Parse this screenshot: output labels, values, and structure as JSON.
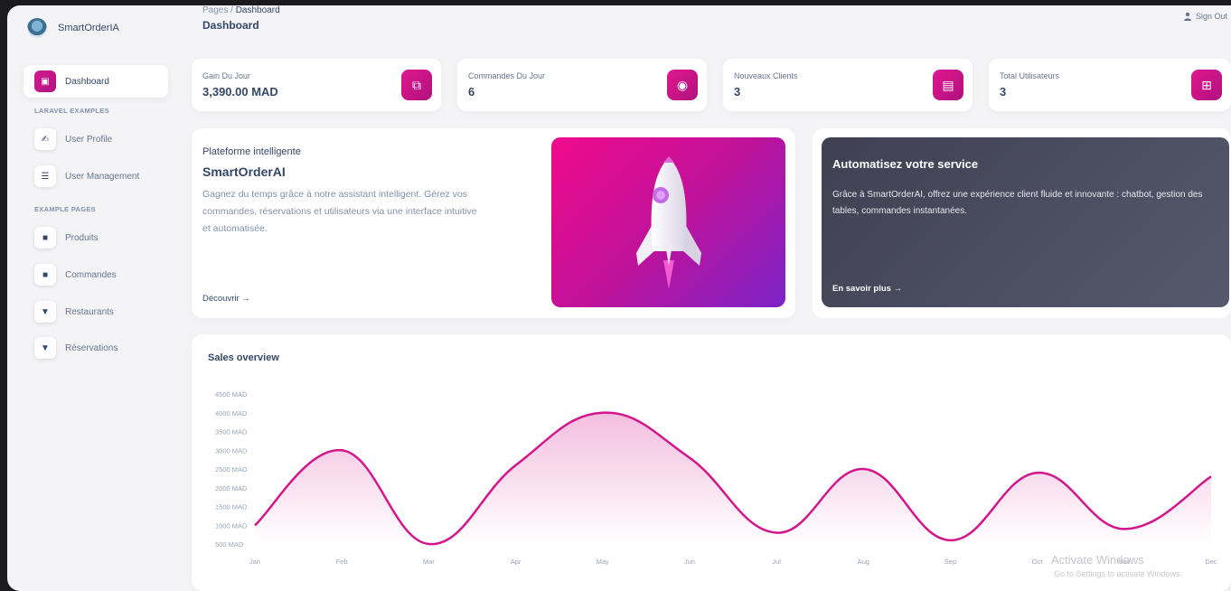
{
  "brand": {
    "name": "SmartOrderIA"
  },
  "breadcrumb": {
    "root": "Pages",
    "separator": "/",
    "current": "Dashboard"
  },
  "page_title": "Dashboard",
  "signout": "Sign Out",
  "sidebar": {
    "items": [
      {
        "label": "Dashboard",
        "icon": "dashboard-icon",
        "glyph": "▣"
      },
      {
        "label": "User Profile",
        "icon": "user-profile-icon",
        "glyph": "✍"
      },
      {
        "label": "User Management",
        "icon": "list-icon",
        "glyph": "☰"
      },
      {
        "label": "Produits",
        "icon": "box-icon",
        "glyph": "■"
      },
      {
        "label": "Commandes",
        "icon": "cart-icon",
        "glyph": "■"
      },
      {
        "label": "Restaurants",
        "icon": "restaurant-icon",
        "glyph": "▼"
      },
      {
        "label": "Réservations",
        "icon": "reservation-icon",
        "glyph": "▼"
      }
    ],
    "sections": [
      "LARAVEL EXAMPLES",
      "EXAMPLE PAGES"
    ]
  },
  "stats": [
    {
      "label": "Gain Du Jour",
      "value": "3,390.00 MAD",
      "icon": "money-icon",
      "glyph": "⧉"
    },
    {
      "label": "Commandes Du Jour",
      "value": "6",
      "icon": "orders-icon",
      "glyph": "◉"
    },
    {
      "label": "Nouveaux Clients",
      "value": "3",
      "icon": "clients-icon",
      "glyph": "▤"
    },
    {
      "label": "Total Utilisateurs",
      "value": "3",
      "icon": "users-icon",
      "glyph": "⊞"
    }
  ],
  "hero": {
    "subtitle": "Plateforme intelligente",
    "title": "SmartOrderAI",
    "description": "Gagnez du temps grâce à notre assistant intelligent. Gérez vos commandes, réservations et utilisateurs via une interface intuitive et automatisée.",
    "link": "Découvrir →"
  },
  "promo": {
    "title": "Automatisez votre service",
    "description": "Grâce à SmartOrderAI, offrez une expérience client fluide et innovante : chatbot, gestion des tables, commandes instantanées.",
    "link": "En savoir plus →"
  },
  "sales": {
    "title": "Sales overview"
  },
  "watermark": {
    "line1": "Activate Windows",
    "line2": "Go to Settings to activate Windows."
  },
  "colors": {
    "accent": "#d4168c",
    "dark_card": "#4a4c5f"
  },
  "chart_data": {
    "type": "area",
    "categories": [
      "Jan",
      "Feb",
      "Mar",
      "Apr",
      "May",
      "Jun",
      "Jul",
      "Aug",
      "Sep",
      "Oct",
      "Nov",
      "Dec"
    ],
    "yticks": [
      "4500 MAD",
      "4000 MAD",
      "3500 MAD",
      "3000 MAD",
      "2500 MAD",
      "2000 MAD",
      "1500 MAD",
      "1000 MAD",
      "500 MAD"
    ],
    "ylim": [
      500,
      4500
    ],
    "series": [
      {
        "values": [
          1000,
          3000,
          500,
          2600,
          4000,
          2800,
          800,
          2500,
          600,
          2400,
          900,
          2300
        ]
      }
    ],
    "grid": false,
    "legend": "none"
  }
}
